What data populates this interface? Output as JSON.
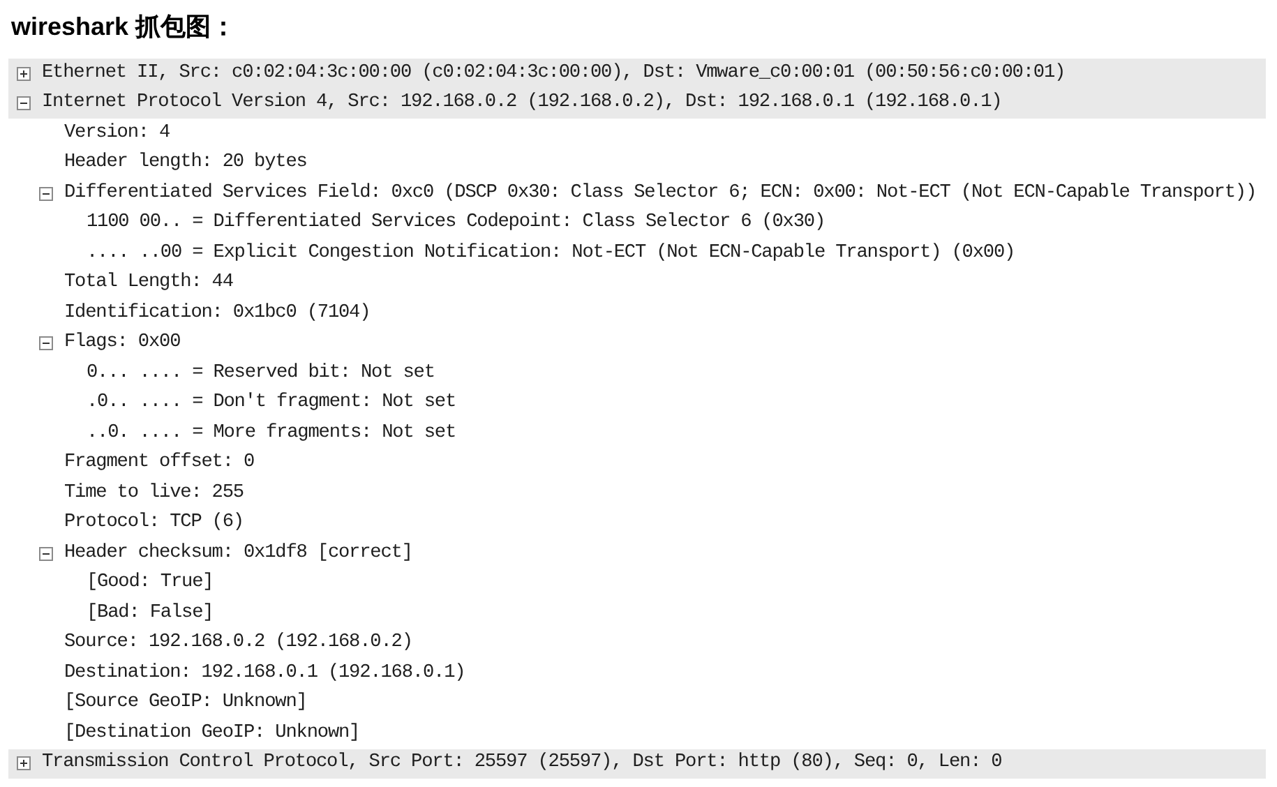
{
  "heading": "wireshark 抓包图：",
  "tree": [
    {
      "label": "Ethernet II, Src: c0:02:04:3c:00:00 (c0:02:04:3c:00:00), Dst: Vmware_c0:00:01 (00:50:56:c0:00:01)",
      "expanded": false
    },
    {
      "label": "Internet Protocol Version 4, Src: 192.168.0.2 (192.168.0.2), Dst: 192.168.0.1 (192.168.0.1)",
      "expanded": true,
      "children": [
        {
          "label": "Version: 4"
        },
        {
          "label": "Header length: 20 bytes"
        },
        {
          "label": "Differentiated Services Field: 0xc0 (DSCP 0x30: Class Selector 6; ECN: 0x00: Not-ECT (Not ECN-Capable Transport))",
          "expanded": true,
          "children": [
            {
              "label": "1100 00.. = Differentiated Services Codepoint: Class Selector 6 (0x30)"
            },
            {
              "label": ".... ..00 = Explicit Congestion Notification: Not-ECT (Not ECN-Capable Transport) (0x00)"
            }
          ]
        },
        {
          "label": "Total Length: 44"
        },
        {
          "label": "Identification: 0x1bc0 (7104)"
        },
        {
          "label": "Flags: 0x00",
          "expanded": true,
          "children": [
            {
              "label": "0... .... = Reserved bit: Not set"
            },
            {
              "label": ".0.. .... = Don't fragment: Not set"
            },
            {
              "label": "..0. .... = More fragments: Not set"
            }
          ]
        },
        {
          "label": "Fragment offset: 0"
        },
        {
          "label": "Time to live: 255"
        },
        {
          "label": "Protocol: TCP (6)"
        },
        {
          "label": "Header checksum: 0x1df8 [correct]",
          "expanded": true,
          "children": [
            {
              "label": "[Good: True]"
            },
            {
              "label": "[Bad: False]"
            }
          ]
        },
        {
          "label": "Source: 192.168.0.2 (192.168.0.2)"
        },
        {
          "label": "Destination: 192.168.0.1 (192.168.0.1)"
        },
        {
          "label": "[Source GeoIP: Unknown]"
        },
        {
          "label": "[Destination GeoIP: Unknown]"
        }
      ]
    },
    {
      "label": "Transmission Control Protocol, Src Port: 25597 (25597), Dst Port: http (80), Seq: 0, Len: 0",
      "expanded": false
    }
  ]
}
